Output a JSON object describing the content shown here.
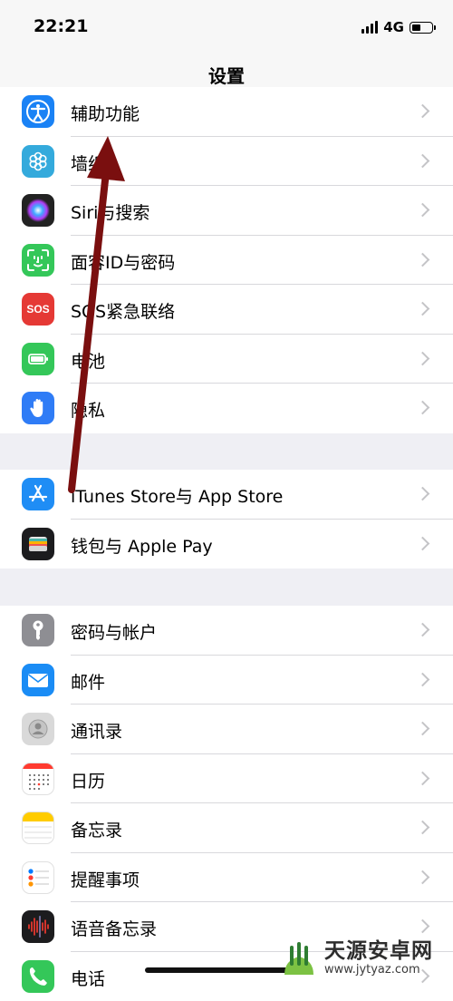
{
  "status_bar": {
    "time": "22:21",
    "network": "4G"
  },
  "nav": {
    "title": "设置"
  },
  "groups": [
    {
      "items": [
        {
          "label": "辅助功能",
          "icon": "accessibility-icon",
          "color": "#1a82f5"
        },
        {
          "label": "墙纸",
          "icon": "wallpaper-icon",
          "color": "#34aadc"
        },
        {
          "label": "Siri与搜索",
          "icon": "siri-icon",
          "color": "#222222"
        },
        {
          "label": "面容ID与密码",
          "icon": "face-id-icon",
          "color": "#34c759"
        },
        {
          "label": "SOS紧急联络",
          "icon": "sos-icon",
          "color": "#e53935",
          "icon_text": "SOS"
        },
        {
          "label": "电池",
          "icon": "battery-icon",
          "color": "#34c759"
        },
        {
          "label": "隐私",
          "icon": "privacy-hand-icon",
          "color": "#2f7cf6"
        }
      ]
    },
    {
      "items": [
        {
          "label": "iTunes Store与 App Store",
          "icon": "app-store-icon",
          "color": "#1f8df5"
        },
        {
          "label": "钱包与 Apple Pay",
          "icon": "wallet-icon",
          "color": "#1c1c1e"
        }
      ]
    },
    {
      "items": [
        {
          "label": "密码与帐户",
          "icon": "key-icon",
          "color": "#8e8e93"
        },
        {
          "label": "邮件",
          "icon": "mail-icon",
          "color": "#1a8cf5"
        },
        {
          "label": "通讯录",
          "icon": "contacts-icon",
          "color": "#d9d9d9"
        },
        {
          "label": "日历",
          "icon": "calendar-icon",
          "color": "#ffffff"
        },
        {
          "label": "备忘录",
          "icon": "notes-icon",
          "color": "#ffffff"
        },
        {
          "label": "提醒事项",
          "icon": "reminders-icon",
          "color": "#ffffff"
        },
        {
          "label": "语音备忘录",
          "icon": "voice-memos-icon",
          "color": "#1c1c1e"
        },
        {
          "label": "电话",
          "icon": "phone-icon",
          "color": "#34c759"
        }
      ]
    }
  ],
  "annotation": {
    "arrow_color": "#7a0f0f"
  },
  "watermark": {
    "title": "天源安卓网",
    "url": "www.jytyaz.com"
  }
}
